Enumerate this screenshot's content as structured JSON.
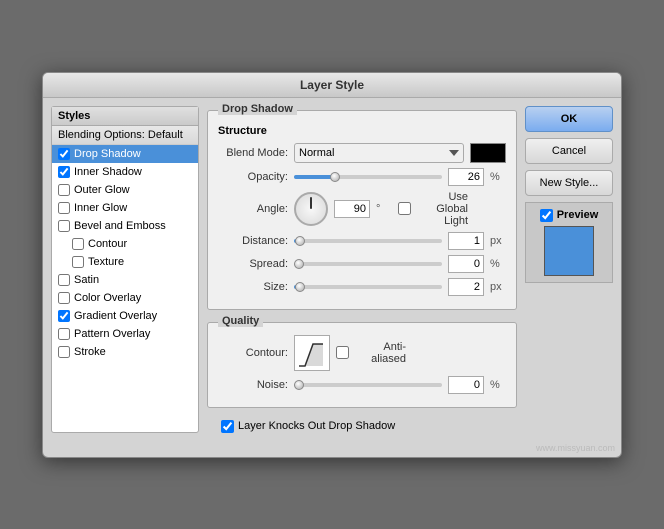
{
  "window": {
    "title": "Layer Style"
  },
  "styles_panel": {
    "header": "Styles",
    "blending": "Blending Options: Default",
    "items": [
      {
        "id": "drop-shadow",
        "label": "Drop Shadow",
        "checked": true,
        "selected": true,
        "sub": false
      },
      {
        "id": "inner-shadow",
        "label": "Inner Shadow",
        "checked": true,
        "selected": false,
        "sub": false
      },
      {
        "id": "outer-glow",
        "label": "Outer Glow",
        "checked": false,
        "selected": false,
        "sub": false
      },
      {
        "id": "inner-glow",
        "label": "Inner Glow",
        "checked": false,
        "selected": false,
        "sub": false
      },
      {
        "id": "bevel-emboss",
        "label": "Bevel and Emboss",
        "checked": false,
        "selected": false,
        "sub": false
      },
      {
        "id": "contour",
        "label": "Contour",
        "checked": false,
        "selected": false,
        "sub": true
      },
      {
        "id": "texture",
        "label": "Texture",
        "checked": false,
        "selected": false,
        "sub": true
      },
      {
        "id": "satin",
        "label": "Satin",
        "checked": false,
        "selected": false,
        "sub": false
      },
      {
        "id": "color-overlay",
        "label": "Color Overlay",
        "checked": false,
        "selected": false,
        "sub": false
      },
      {
        "id": "gradient-overlay",
        "label": "Gradient Overlay",
        "checked": true,
        "selected": false,
        "sub": false
      },
      {
        "id": "pattern-overlay",
        "label": "Pattern Overlay",
        "checked": false,
        "selected": false,
        "sub": false
      },
      {
        "id": "stroke",
        "label": "Stroke",
        "checked": false,
        "selected": false,
        "sub": false
      }
    ]
  },
  "drop_shadow": {
    "section_title": "Drop Shadow",
    "structure_title": "Structure",
    "blend_mode_label": "Blend Mode:",
    "blend_mode_value": "Normal",
    "opacity_label": "Opacity:",
    "opacity_value": "26",
    "opacity_unit": "%",
    "angle_label": "Angle:",
    "angle_value": "90",
    "angle_unit": "°",
    "use_global_light_label": "Use Global Light",
    "use_global_light_checked": false,
    "distance_label": "Distance:",
    "distance_value": "1",
    "distance_unit": "px",
    "spread_label": "Spread:",
    "spread_value": "0",
    "spread_unit": "%",
    "size_label": "Size:",
    "size_value": "2",
    "size_unit": "px",
    "quality_title": "Quality",
    "contour_label": "Contour:",
    "anti_aliased_label": "Anti-aliased",
    "anti_aliased_checked": false,
    "noise_label": "Noise:",
    "noise_value": "0",
    "noise_unit": "%",
    "layer_knocks_label": "Layer Knocks Out Drop Shadow",
    "layer_knocks_checked": true
  },
  "buttons": {
    "ok": "OK",
    "cancel": "Cancel",
    "new_style": "New Style..."
  },
  "preview": {
    "label": "Preview",
    "checked": true
  },
  "watermark": "www.missyuan.com"
}
